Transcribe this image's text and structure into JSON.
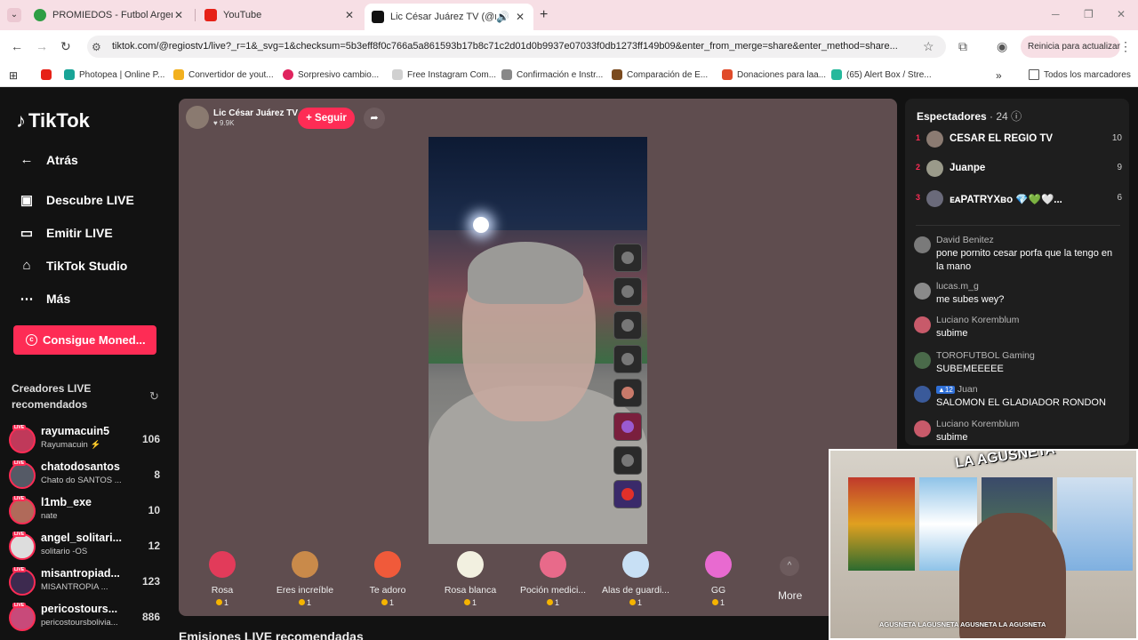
{
  "browser": {
    "tabs": [
      {
        "title": "PROMIEDOS - Futbol Argentina",
        "color": "#2e9e44"
      },
      {
        "title": "YouTube",
        "color": "#e62117"
      },
      {
        "title": "Lic César Juárez TV (@regio",
        "color": "#111111"
      }
    ],
    "url": "tiktok.com/@regiostv1/live?_r=1&_svg=1&checksum=5b3eff8f0c766a5a861593b17b8c71c2d01d0b9937e07033f0db1273ff149b09&enter_from_merge=share&enter_method=share...",
    "restart_label": "Reinicia para actualizar",
    "bookmarks": [
      {
        "label": "Photopea | Online P...",
        "color": "#18a497"
      },
      {
        "label": "Convertidor de yout...",
        "color": "#f2b01e"
      },
      {
        "label": "Sorpresivo cambio...",
        "color": "#e0245e"
      },
      {
        "label": "Free Instagram Com...",
        "color": "#d0d0d0"
      },
      {
        "label": "Confirmación e Instr...",
        "color": "#888888"
      },
      {
        "label": "Comparación de E...",
        "color": "#7a4a1e"
      },
      {
        "label": "Donaciones para laa...",
        "color": "#e04b2a"
      },
      {
        "label": "(65) Alert Box / Stre...",
        "color": "#25b89c"
      }
    ],
    "all_bookmarks_label": "Todos los marcadores"
  },
  "sidebar": {
    "logo": "TikTok",
    "nav": [
      {
        "label": "Atrás",
        "icon": "arrow-left-icon"
      },
      {
        "label": "Descubre LIVE",
        "icon": "calendar-live-icon"
      },
      {
        "label": "Emitir LIVE",
        "icon": "camera-icon"
      },
      {
        "label": "TikTok Studio",
        "icon": "studio-icon"
      },
      {
        "label": "Más",
        "icon": "more-icon"
      }
    ],
    "coins_button": "Consigue Moned...",
    "recommended_title": "Creadores LIVE recomendados",
    "live_badge": "LIVE",
    "creators": [
      {
        "name": "rayumacuin5",
        "sub": "Rayumacuin ⚡",
        "count": "106",
        "color": "#c0395a"
      },
      {
        "name": "chatodosantos",
        "sub": "Chato do SANTOS ...",
        "count": "8",
        "color": "#555a66"
      },
      {
        "name": "l1mb_exe",
        "sub": "nate",
        "count": "10",
        "color": "#b06a5a"
      },
      {
        "name": "angel_solitari...",
        "sub": "solitario -OS",
        "count": "12",
        "color": "#dddddd"
      },
      {
        "name": "misantropiad...",
        "sub": "MISANTROPIA ...",
        "count": "123",
        "color": "#3d2a4f"
      },
      {
        "name": "pericostours...",
        "sub": "pericostoursbolivia...",
        "count": "886",
        "color": "#c84a7a"
      }
    ]
  },
  "live": {
    "host_name": "Lic César Juárez TV",
    "host_likes": "♥ 9.9K",
    "follow_label": "+ Seguir",
    "gifts": [
      {
        "name": "Rosa",
        "price": "1",
        "color": "#e23b5a"
      },
      {
        "name": "Eres increíble",
        "price": "1",
        "color": "#c98a4a"
      },
      {
        "name": "Te adoro",
        "price": "1",
        "color": "#f05a3a"
      },
      {
        "name": "Rosa blanca",
        "price": "1",
        "color": "#f2f0e0"
      },
      {
        "name": "Poción medici...",
        "price": "1",
        "color": "#e86a8a"
      },
      {
        "name": "Alas de guardi...",
        "price": "1",
        "color": "#c8e0f5"
      },
      {
        "name": "GG",
        "price": "1",
        "color": "#e86ad0"
      }
    ],
    "more_label": "More",
    "recommended_live_title": "Emisiones LIVE recomendadas"
  },
  "viewers": {
    "title": "Espectadores",
    "count": "· 24",
    "top": [
      {
        "rank": "1",
        "name": "CESAR EL REGIO TV",
        "score": "10"
      },
      {
        "rank": "2",
        "name": "Juanpe",
        "score": "9"
      },
      {
        "rank": "3",
        "name": "ᴇᴀPATRYXʙᴏ 💎💚🤍...",
        "score": "6"
      }
    ],
    "chat": [
      {
        "user": "David Benitez",
        "level": "",
        "message": "pone pornito cesar porfa que la tengo en la mano",
        "color": "#7a7a7a"
      },
      {
        "user": "lucas.m_g",
        "level": "",
        "message": "me subes wey?",
        "color": "#8a8a8a"
      },
      {
        "user": "Luciano Koremblum",
        "level": "",
        "message": "subime",
        "color": "#c85a6a"
      },
      {
        "user": "TOROFUTBOL Gaming",
        "level": "",
        "message": "SUBEMEEEEE",
        "color": "#4a6a4a"
      },
      {
        "user": "Juan",
        "level": "12",
        "message": "SALOMON EL GLADIADOR RONDON",
        "color": "#3a5a9a"
      },
      {
        "user": "Luciano Koremblum",
        "level": "",
        "message": "subime",
        "color": "#c85a6a"
      }
    ]
  },
  "webcam": {
    "brand": "LA AGUSNETA",
    "social": "AGUSNETA  LAGUSNETA  AGUSNETA  LA AGUSNETA"
  }
}
